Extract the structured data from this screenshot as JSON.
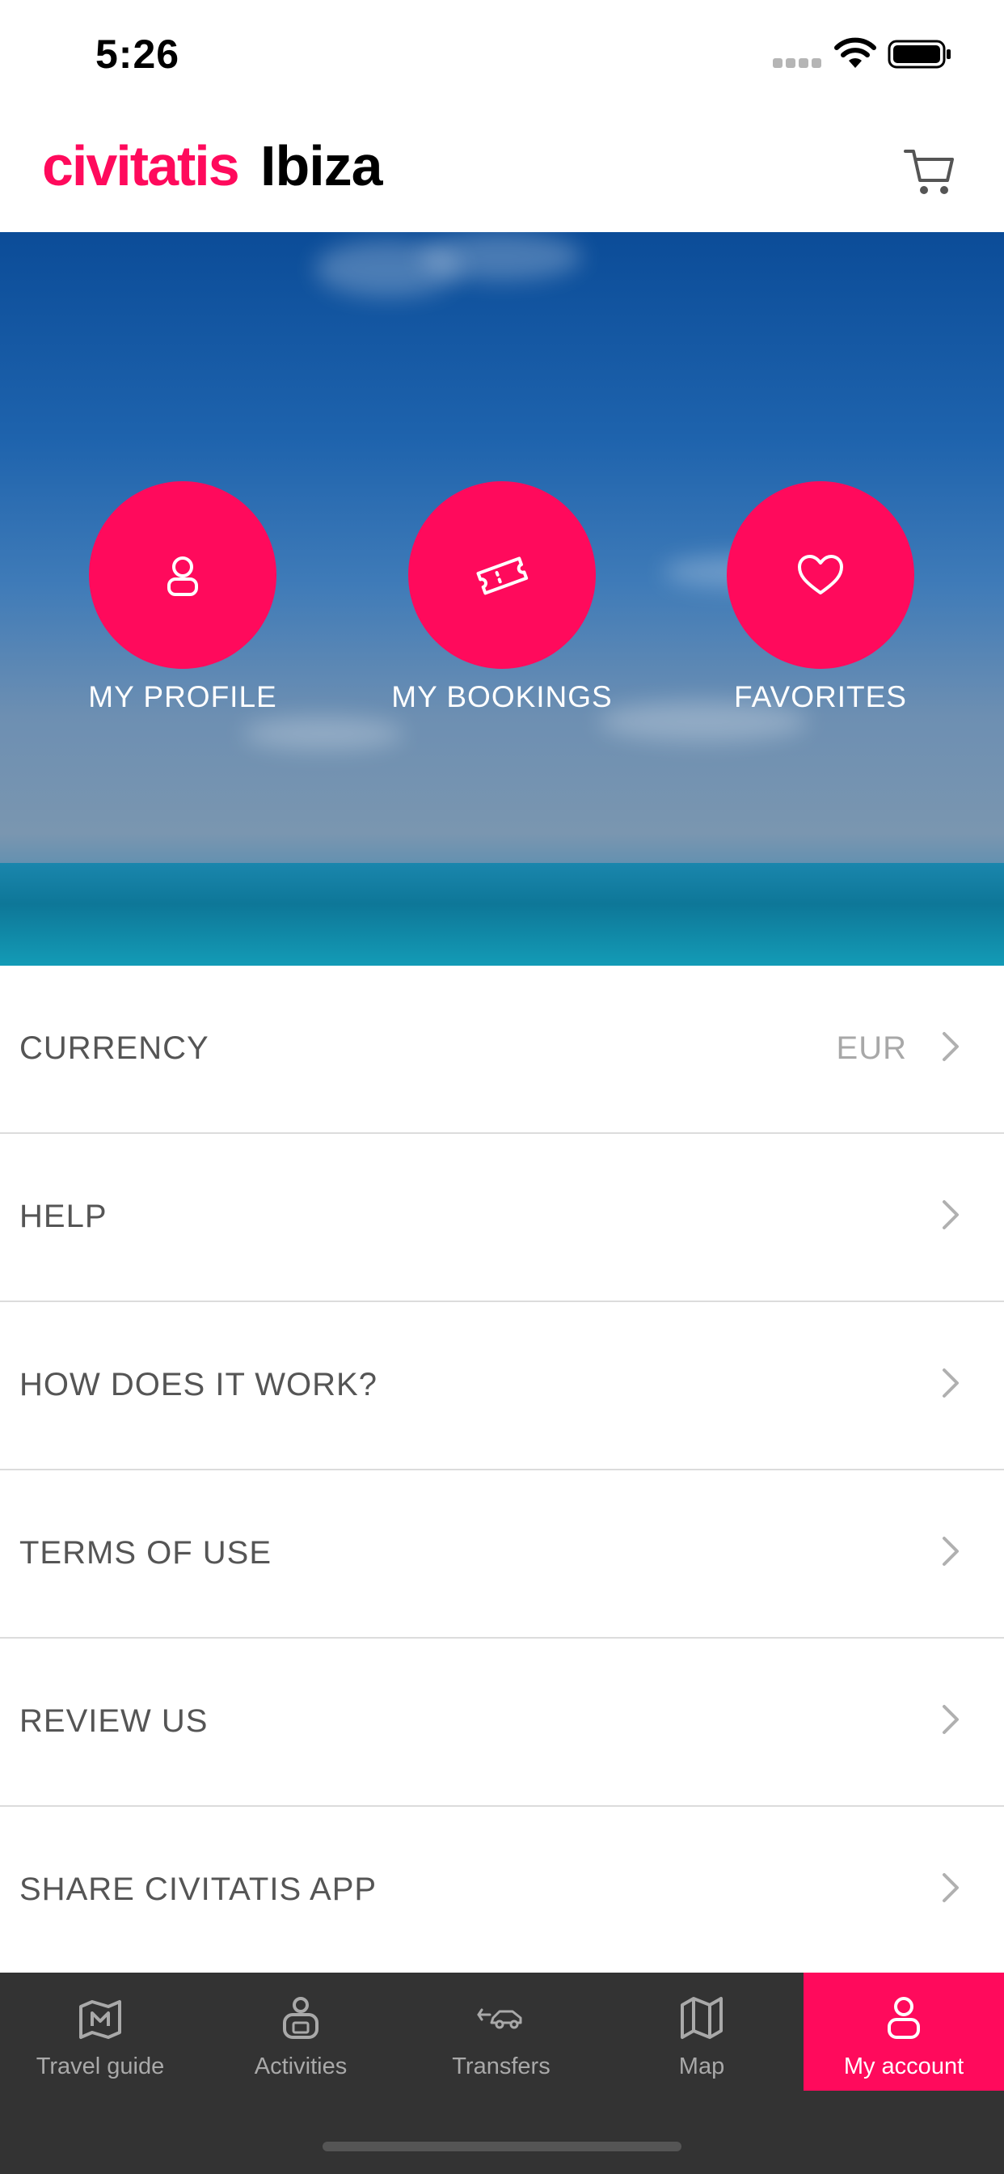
{
  "status_bar": {
    "time": "5:26"
  },
  "header": {
    "brand": "civitatis",
    "city": "Ibiza"
  },
  "hero_actions": [
    {
      "label": "MY PROFILE",
      "icon": "person-icon"
    },
    {
      "label": "MY BOOKINGS",
      "icon": "ticket-icon"
    },
    {
      "label": "FAVORITES",
      "icon": "heart-icon"
    }
  ],
  "menu": {
    "items": [
      {
        "label": "CURRENCY",
        "value": "EUR"
      },
      {
        "label": "HELP"
      },
      {
        "label": "HOW DOES IT WORK?"
      },
      {
        "label": "TERMS OF USE"
      },
      {
        "label": "REVIEW US"
      },
      {
        "label": "SHARE CIVITATIS APP"
      }
    ]
  },
  "tabs": [
    {
      "label": "Travel guide",
      "icon": "map-pin-icon"
    },
    {
      "label": "Activities",
      "icon": "activities-icon"
    },
    {
      "label": "Transfers",
      "icon": "car-icon"
    },
    {
      "label": "Map",
      "icon": "map-icon"
    },
    {
      "label": "My account",
      "icon": "user-icon",
      "active": true
    }
  ],
  "colors": {
    "accent": "#ff0a5c",
    "tab_bar": "#333333"
  }
}
